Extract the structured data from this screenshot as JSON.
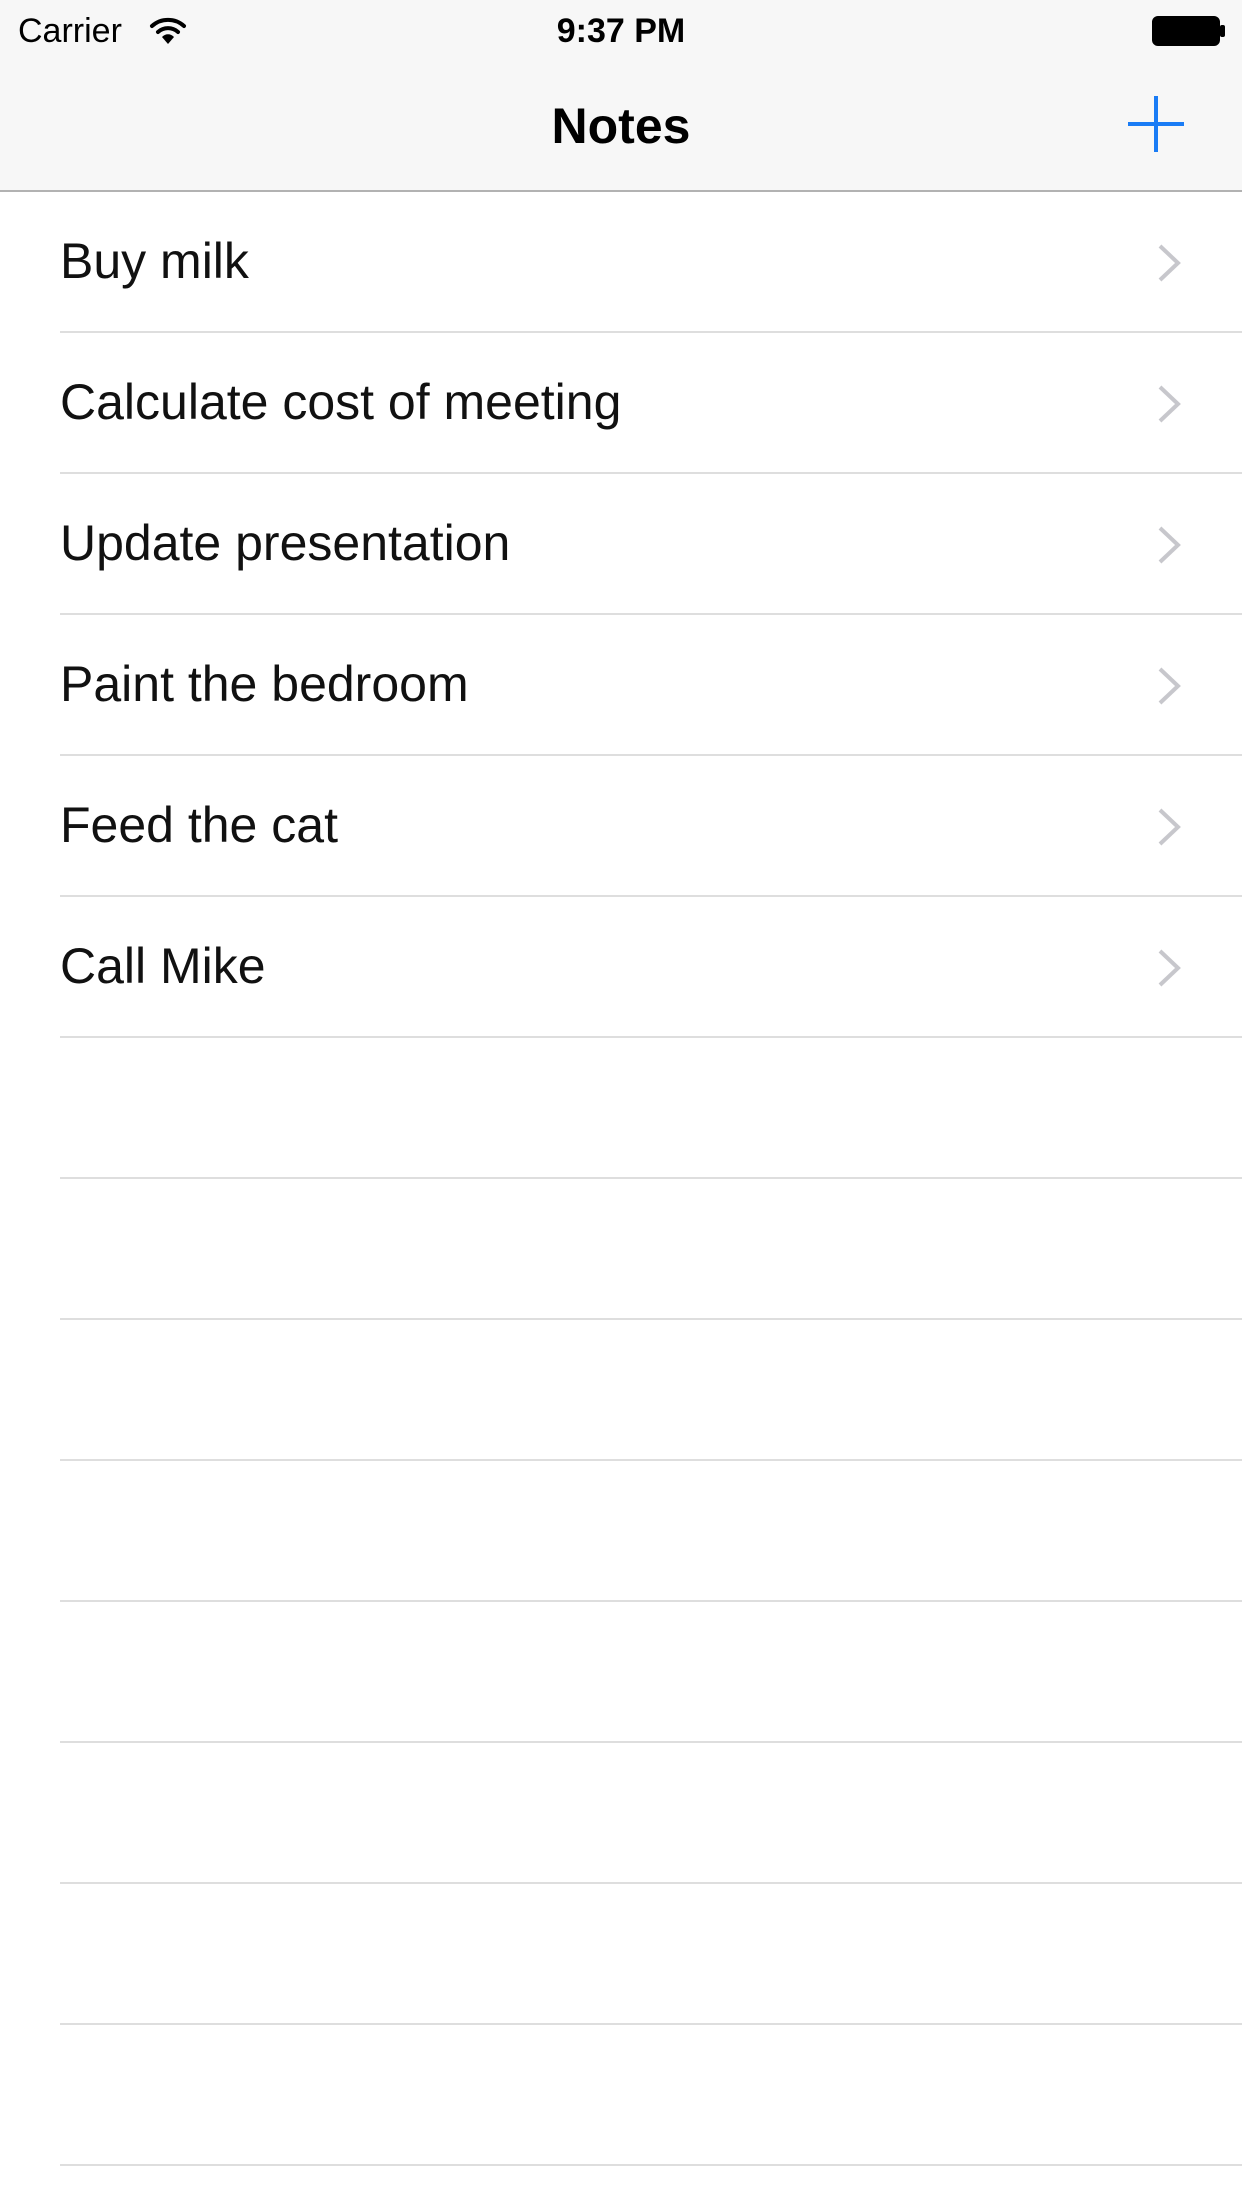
{
  "status_bar": {
    "carrier": "Carrier",
    "time": "9:37 PM",
    "wifi_icon": "wifi-icon",
    "battery_icon": "battery-icon"
  },
  "nav_bar": {
    "title": "Notes",
    "add_icon": "plus-icon",
    "accent_color": "#1a7cf5"
  },
  "notes": [
    {
      "label": "Buy milk"
    },
    {
      "label": "Calculate cost of meeting"
    },
    {
      "label": "Update presentation"
    },
    {
      "label": "Paint the bedroom"
    },
    {
      "label": "Feed the cat"
    },
    {
      "label": "Call Mike"
    },
    {
      "label": ""
    },
    {
      "label": ""
    },
    {
      "label": ""
    },
    {
      "label": ""
    },
    {
      "label": ""
    },
    {
      "label": ""
    },
    {
      "label": ""
    },
    {
      "label": ""
    }
  ],
  "colors": {
    "bar_background": "#f7f7f7",
    "separator": "#dedede",
    "chevron": "#c7c7cc",
    "text": "#111111"
  }
}
